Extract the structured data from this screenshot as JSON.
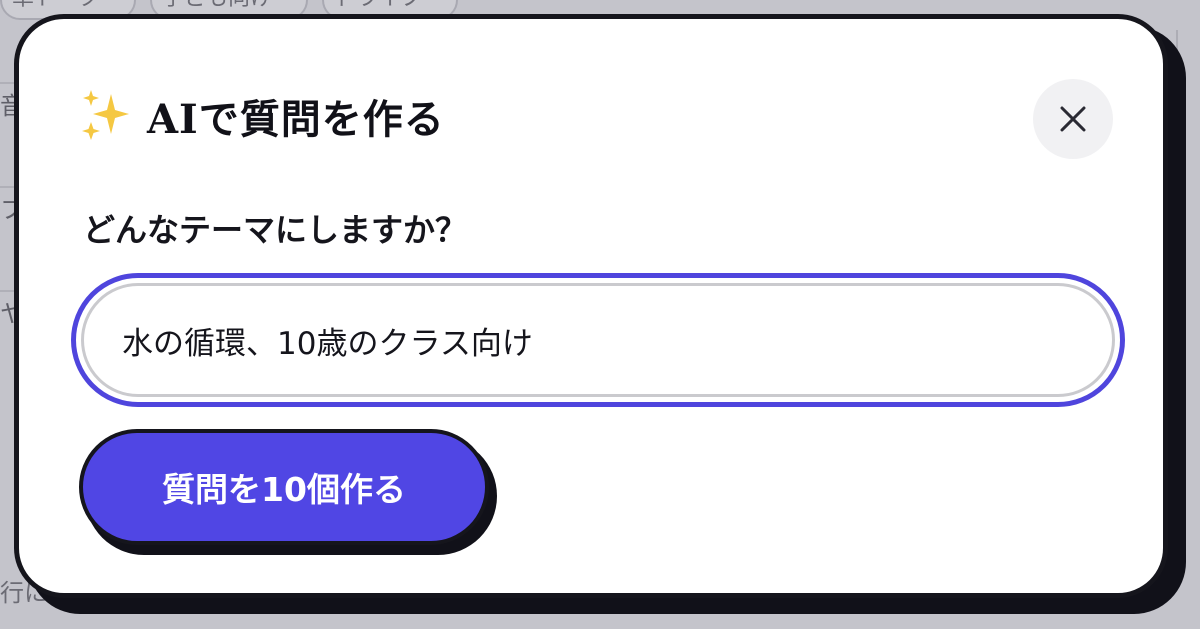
{
  "background": {
    "pills": [
      "草トーク",
      "子ども向け",
      "ドライブ"
    ],
    "rows": [
      "音",
      "フ",
      "ヤ"
    ],
    "bottom_text": "行に"
  },
  "modal": {
    "title": "AIで質問を作る",
    "title_icon": "sparkles-icon",
    "close_icon": "close-icon",
    "prompt_label": "どんなテーマにしますか？",
    "theme_input": {
      "value": "水の循環、10歳のクラス向け",
      "placeholder": ""
    },
    "generate_button_label": "質問を10個作る"
  },
  "colors": {
    "accent": "#5046e4",
    "ink": "#15151c",
    "close_bg": "#f1f1f3",
    "sparkle": "#f5c842"
  }
}
